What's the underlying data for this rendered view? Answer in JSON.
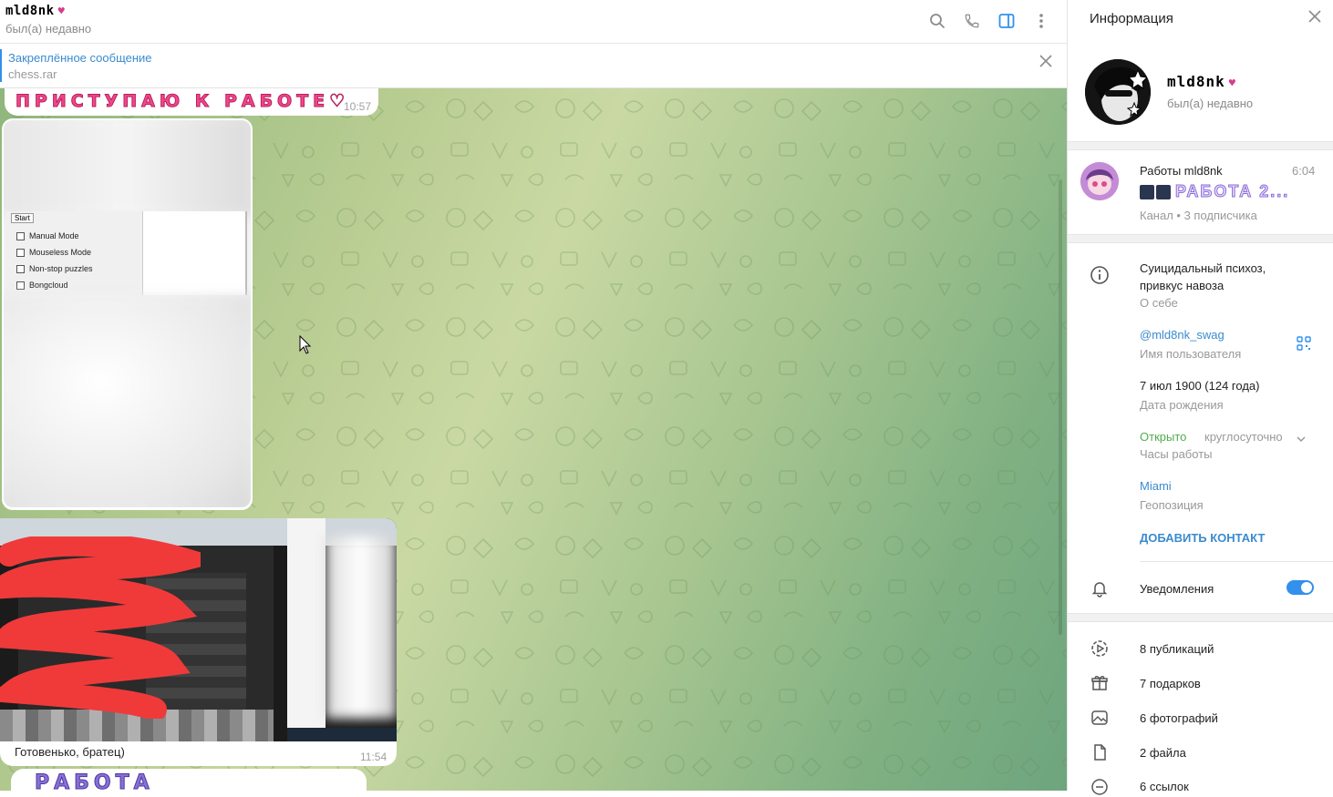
{
  "header": {
    "name": "mld8nk",
    "heart": "♥",
    "status": "был(а) недавно"
  },
  "pinned": {
    "title": "Закреплённое сообщение",
    "text": "chess.rar"
  },
  "messages": {
    "sticker1": {
      "text": "ПРИСТУПАЮ К РАБОТЕ♡",
      "time": "10:57"
    },
    "screenshot1": {
      "button": "Start",
      "options": [
        "Manual Mode",
        "Mouseless Mode",
        "Non-stop puzzles",
        "Bongcloud"
      ]
    },
    "screenshot2": {
      "caption": "Готовенько, братец)",
      "time": "11:54"
    },
    "sticker2": {
      "text": "РАБОТА ВЫПОЛНЕНА!"
    }
  },
  "sidebar": {
    "title": "Информация",
    "profile": {
      "name": "mld8nk",
      "heart": "♥",
      "status": "был(а) недавно"
    },
    "channel": {
      "name": "Работы mld8nk",
      "time": "6:04",
      "preview": "РАБОТА 2...",
      "meta": "Канал • 3 подписчика"
    },
    "about": {
      "value": "Суицидальный психоз, привкус навоза",
      "label": "О себе"
    },
    "username": {
      "value": "@mld8nk_swag",
      "label": "Имя пользователя"
    },
    "birthday": {
      "value": "7 июл 1900 (124 года)",
      "label": "Дата рождения"
    },
    "hours": {
      "open": "Открыто",
      "schedule": "круглосуточно",
      "label": "Часы работы"
    },
    "location": {
      "value": "Miami",
      "label": "Геопозиция"
    },
    "add_contact": "ДОБАВИТЬ КОНТАКТ",
    "notifications": {
      "label": "Уведомления",
      "enabled": true
    },
    "media": [
      {
        "label": "8 публикаций",
        "icon": "stories-icon"
      },
      {
        "label": "7 подарков",
        "icon": "gift-icon"
      },
      {
        "label": "6 фотографий",
        "icon": "photo-icon"
      },
      {
        "label": "2 файла",
        "icon": "file-icon"
      },
      {
        "label": "6 ссылок",
        "icon": "link-icon"
      }
    ]
  },
  "colors": {
    "accent": "#3390ec",
    "green": "#4fae4e",
    "sticker_pink": "#f2478c",
    "sticker_purple": "#8a6fd6"
  }
}
